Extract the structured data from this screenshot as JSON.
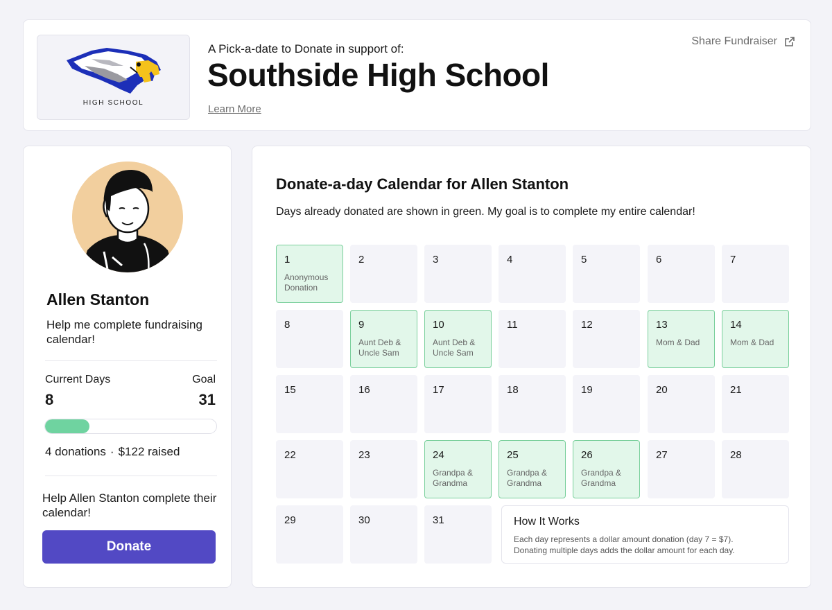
{
  "colors": {
    "accent": "#5249c4",
    "donated_fill": "#e2f7ea",
    "donated_border": "#79cf9b",
    "empty_day": "#f4f4f9",
    "progress": "#6fd3a0",
    "page_bg": "#f3f3f8"
  },
  "header": {
    "logo_caption": "HIGH SCHOOL",
    "subtitle": "A Pick-a-date to Donate in support of:",
    "school_name": "Southside High School",
    "learn_more": "Learn More",
    "share_label": "Share Fundraiser",
    "share_icon": "external-link-icon"
  },
  "profile": {
    "name": "Allen Stanton",
    "message": "Help me complete fundraising calendar!",
    "current_days_label": "Current Days",
    "current_days": "8",
    "goal_label": "Goal",
    "goal": "31",
    "progress_fraction": 0.258,
    "donations": "4 donations",
    "separator": "·",
    "raised": "$122 raised",
    "help_text": "Help Allen Stanton complete their calendar!",
    "donate_label": "Donate"
  },
  "calendar": {
    "title": "Donate-a-day Calendar for Allen Stanton",
    "description": "Days already donated are shown in green. My goal is to complete my entire calendar!",
    "days": [
      {
        "day": "1",
        "donor": "Anonymous Donation"
      },
      {
        "day": "2",
        "donor": ""
      },
      {
        "day": "3",
        "donor": ""
      },
      {
        "day": "4",
        "donor": ""
      },
      {
        "day": "5",
        "donor": ""
      },
      {
        "day": "6",
        "donor": ""
      },
      {
        "day": "7",
        "donor": ""
      },
      {
        "day": "8",
        "donor": ""
      },
      {
        "day": "9",
        "donor": "Aunt Deb & Uncle Sam"
      },
      {
        "day": "10",
        "donor": "Aunt Deb & Uncle Sam"
      },
      {
        "day": "11",
        "donor": ""
      },
      {
        "day": "12",
        "donor": ""
      },
      {
        "day": "13",
        "donor": "Mom & Dad"
      },
      {
        "day": "14",
        "donor": "Mom & Dad"
      },
      {
        "day": "15",
        "donor": ""
      },
      {
        "day": "16",
        "donor": ""
      },
      {
        "day": "17",
        "donor": ""
      },
      {
        "day": "18",
        "donor": ""
      },
      {
        "day": "19",
        "donor": ""
      },
      {
        "day": "20",
        "donor": ""
      },
      {
        "day": "21",
        "donor": ""
      },
      {
        "day": "22",
        "donor": ""
      },
      {
        "day": "23",
        "donor": ""
      },
      {
        "day": "24",
        "donor": "Grandpa & Grandma"
      },
      {
        "day": "25",
        "donor": "Grandpa & Grandma"
      },
      {
        "day": "26",
        "donor": "Grandpa & Grandma"
      },
      {
        "day": "27",
        "donor": ""
      },
      {
        "day": "28",
        "donor": ""
      },
      {
        "day": "29",
        "donor": ""
      },
      {
        "day": "30",
        "donor": ""
      },
      {
        "day": "31",
        "donor": ""
      }
    ],
    "how_it_works": {
      "title": "How It Works",
      "line1": "Each day represents a dollar amount donation (day 7 = $7).",
      "line2": "Donating multiple days adds the dollar amount for each day."
    }
  }
}
